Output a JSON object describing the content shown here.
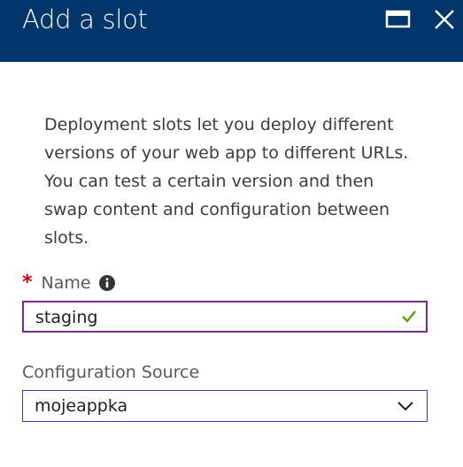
{
  "header": {
    "title": "Add a slot",
    "maximize_icon": "maximize-icon",
    "close_icon": "close-icon",
    "background": "#00366b"
  },
  "description": "Deployment slots let you deploy different versions of your web app to different URLs. You can test a certain version and then swap content and configuration between slots.",
  "name_field": {
    "required_mark": "*",
    "label": "Name",
    "info_icon": "info-icon",
    "value": "staging",
    "valid_icon": "checkmark-icon",
    "valid_color": "#57a300",
    "border_color": "#7d2a8e"
  },
  "config_source": {
    "label": "Configuration Source",
    "selected": "mojeappka",
    "chevron_icon": "chevron-down-icon"
  }
}
